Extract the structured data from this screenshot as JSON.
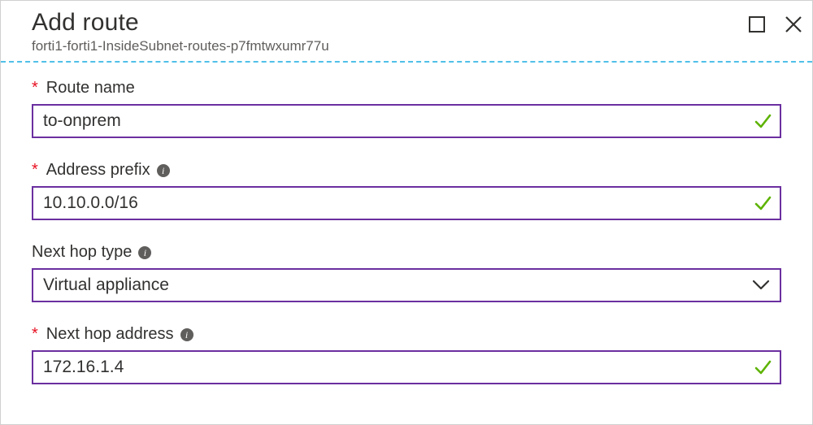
{
  "header": {
    "title": "Add route",
    "subtitle": "forti1-forti1-InsideSubnet-routes-p7fmtwxumr77u"
  },
  "fields": {
    "routeName": {
      "label": "Route name",
      "required": true,
      "value": "to-onprem",
      "valid": true,
      "hasInfo": false
    },
    "addressPrefix": {
      "label": "Address prefix",
      "required": true,
      "value": "10.10.0.0/16",
      "valid": true,
      "hasInfo": true
    },
    "nextHopType": {
      "label": "Next hop type",
      "required": false,
      "value": "Virtual appliance",
      "hasInfo": true
    },
    "nextHopAddress": {
      "label": "Next hop address",
      "required": true,
      "value": "172.16.1.4",
      "valid": true,
      "hasInfo": true
    }
  }
}
